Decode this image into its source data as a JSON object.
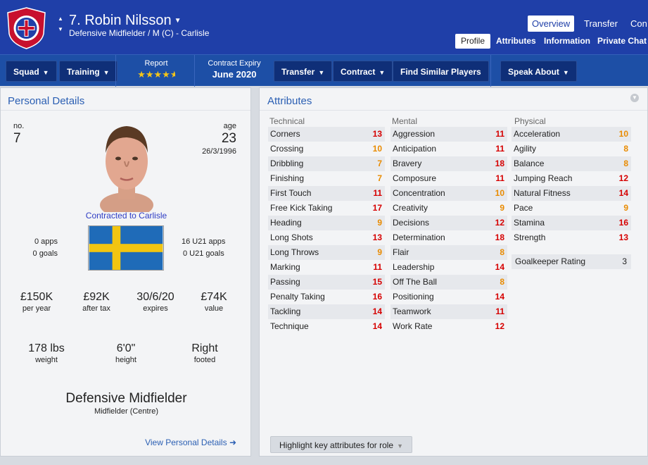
{
  "header": {
    "title": "7. Robin Nilsson",
    "subtitle": "Defensive Midfielder / M (C) - Carlisle",
    "crest_name": "Carlisle United Football Club",
    "tabs_top": [
      "Overview",
      "Transfer",
      "Con"
    ],
    "tabs_sub": [
      "Profile",
      "Attributes",
      "Information",
      "Private Chat"
    ],
    "active_top": "Overview",
    "active_sub": "Profile"
  },
  "toolbar": {
    "squad": "Squad",
    "training": "Training",
    "report_label": "Report",
    "report_stars": 4.5,
    "contract_label": "Contract Expiry",
    "contract_value": "June 2020",
    "transfer": "Transfer",
    "contract": "Contract",
    "find_similar": "Find Similar Players",
    "speak_about": "Speak About"
  },
  "personal": {
    "panel_title": "Personal Details",
    "no_label": "no.",
    "no_value": "7",
    "age_label": "age",
    "age_value": "23",
    "dob": "26/3/1996",
    "contracted": "Contracted to Carlisle",
    "apps": "0 apps",
    "goals": "0 goals",
    "u21_apps": "16 U21 apps",
    "u21_goals": "0 U21 goals",
    "nationality_flag": "Sweden",
    "wage": {
      "value": "£150K",
      "label": "per year"
    },
    "after_tax": {
      "value": "£92K",
      "label": "after tax"
    },
    "expires": {
      "value": "30/6/20",
      "label": "expires"
    },
    "market_value": {
      "value": "£74K",
      "label": "value"
    },
    "weight": {
      "value": "178 lbs",
      "label": "weight"
    },
    "height": {
      "value": "6'0\"",
      "label": "height"
    },
    "footed": {
      "value": "Right",
      "label": "footed"
    },
    "role": "Defensive Midfielder",
    "position": "Midfielder (Centre)",
    "view_link": "View Personal Details"
  },
  "attributes": {
    "panel_title": "Attributes",
    "colors": {
      "high": "#d60000",
      "mid": "#e98b00"
    },
    "columns": [
      {
        "heading": "Technical",
        "items": [
          {
            "name": "Corners",
            "value": "13"
          },
          {
            "name": "Crossing",
            "value": "10"
          },
          {
            "name": "Dribbling",
            "value": "7"
          },
          {
            "name": "Finishing",
            "value": "7"
          },
          {
            "name": "First Touch",
            "value": "11"
          },
          {
            "name": "Free Kick Taking",
            "value": "17"
          },
          {
            "name": "Heading",
            "value": "9"
          },
          {
            "name": "Long Shots",
            "value": "13"
          },
          {
            "name": "Long Throws",
            "value": "9"
          },
          {
            "name": "Marking",
            "value": "11"
          },
          {
            "name": "Passing",
            "value": "15"
          },
          {
            "name": "Penalty Taking",
            "value": "16"
          },
          {
            "name": "Tackling",
            "value": "14"
          },
          {
            "name": "Technique",
            "value": "14"
          }
        ]
      },
      {
        "heading": "Mental",
        "items": [
          {
            "name": "Aggression",
            "value": "11"
          },
          {
            "name": "Anticipation",
            "value": "11"
          },
          {
            "name": "Bravery",
            "value": "18"
          },
          {
            "name": "Composure",
            "value": "11"
          },
          {
            "name": "Concentration",
            "value": "10"
          },
          {
            "name": "Creativity",
            "value": "9"
          },
          {
            "name": "Decisions",
            "value": "12"
          },
          {
            "name": "Determination",
            "value": "18"
          },
          {
            "name": "Flair",
            "value": "8"
          },
          {
            "name": "Leadership",
            "value": "14"
          },
          {
            "name": "Off The Ball",
            "value": "8"
          },
          {
            "name": "Positioning",
            "value": "14"
          },
          {
            "name": "Teamwork",
            "value": "11"
          },
          {
            "name": "Work Rate",
            "value": "12"
          }
        ]
      },
      {
        "heading": "Physical",
        "items": [
          {
            "name": "Acceleration",
            "value": "10"
          },
          {
            "name": "Agility",
            "value": "8"
          },
          {
            "name": "Balance",
            "value": "8"
          },
          {
            "name": "Jumping Reach",
            "value": "12"
          },
          {
            "name": "Natural Fitness",
            "value": "14"
          },
          {
            "name": "Pace",
            "value": "9"
          },
          {
            "name": "Stamina",
            "value": "16"
          },
          {
            "name": "Strength",
            "value": "13"
          }
        ]
      }
    ],
    "goalkeeper_label": "Goalkeeper Rating",
    "goalkeeper_value": "3",
    "highlight_button": "Highlight key attributes for role"
  }
}
